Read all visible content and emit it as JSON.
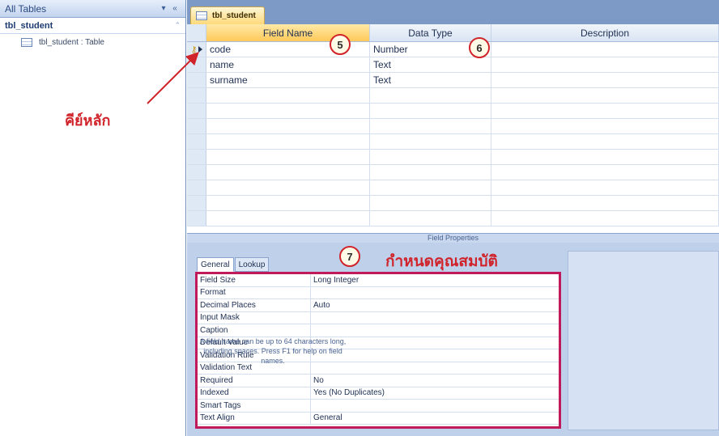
{
  "nav": {
    "header_title": "All Tables",
    "header_dropdown": "▾",
    "header_close": "«",
    "group_label": "tbl_student",
    "group_chevron": "⌃",
    "item_label": "tbl_student : Table"
  },
  "annotations": {
    "primary_key": "คีย์หลัก",
    "step5": "5",
    "step6": "6",
    "step7": "7",
    "set_properties": "กำหนดคุณสมบัติ"
  },
  "document": {
    "tab_label": "tbl_student"
  },
  "grid": {
    "headers": {
      "field_name": "Field Name",
      "data_type": "Data Type",
      "description": "Description"
    },
    "rows": [
      {
        "field": "code",
        "type": "Number",
        "primary_key": true
      },
      {
        "field": "name",
        "type": "Text",
        "primary_key": false
      },
      {
        "field": "surname",
        "type": "Text",
        "primary_key": false
      }
    ],
    "pk_icon": "key-icon"
  },
  "props": {
    "bar_label": "Field Properties",
    "tab_general": "General",
    "tab_lookup": "Lookup",
    "rows": [
      {
        "name": "Field Size",
        "value": "Long Integer"
      },
      {
        "name": "Format",
        "value": ""
      },
      {
        "name": "Decimal Places",
        "value": "Auto"
      },
      {
        "name": "Input Mask",
        "value": ""
      },
      {
        "name": "Caption",
        "value": ""
      },
      {
        "name": "Default Value",
        "value": ""
      },
      {
        "name": "Validation Rule",
        "value": ""
      },
      {
        "name": "Validation Text",
        "value": ""
      },
      {
        "name": "Required",
        "value": "No"
      },
      {
        "name": "Indexed",
        "value": "Yes (No Duplicates)"
      },
      {
        "name": "Smart Tags",
        "value": ""
      },
      {
        "name": "Text Align",
        "value": "General"
      }
    ],
    "help_text": "A field name can be up to 64 characters long, including spaces. Press F1 for help on field names."
  },
  "colors": {
    "annotation_red": "#d0242a",
    "props_border": "#c01a5b",
    "active_header": "#ffc95a"
  }
}
